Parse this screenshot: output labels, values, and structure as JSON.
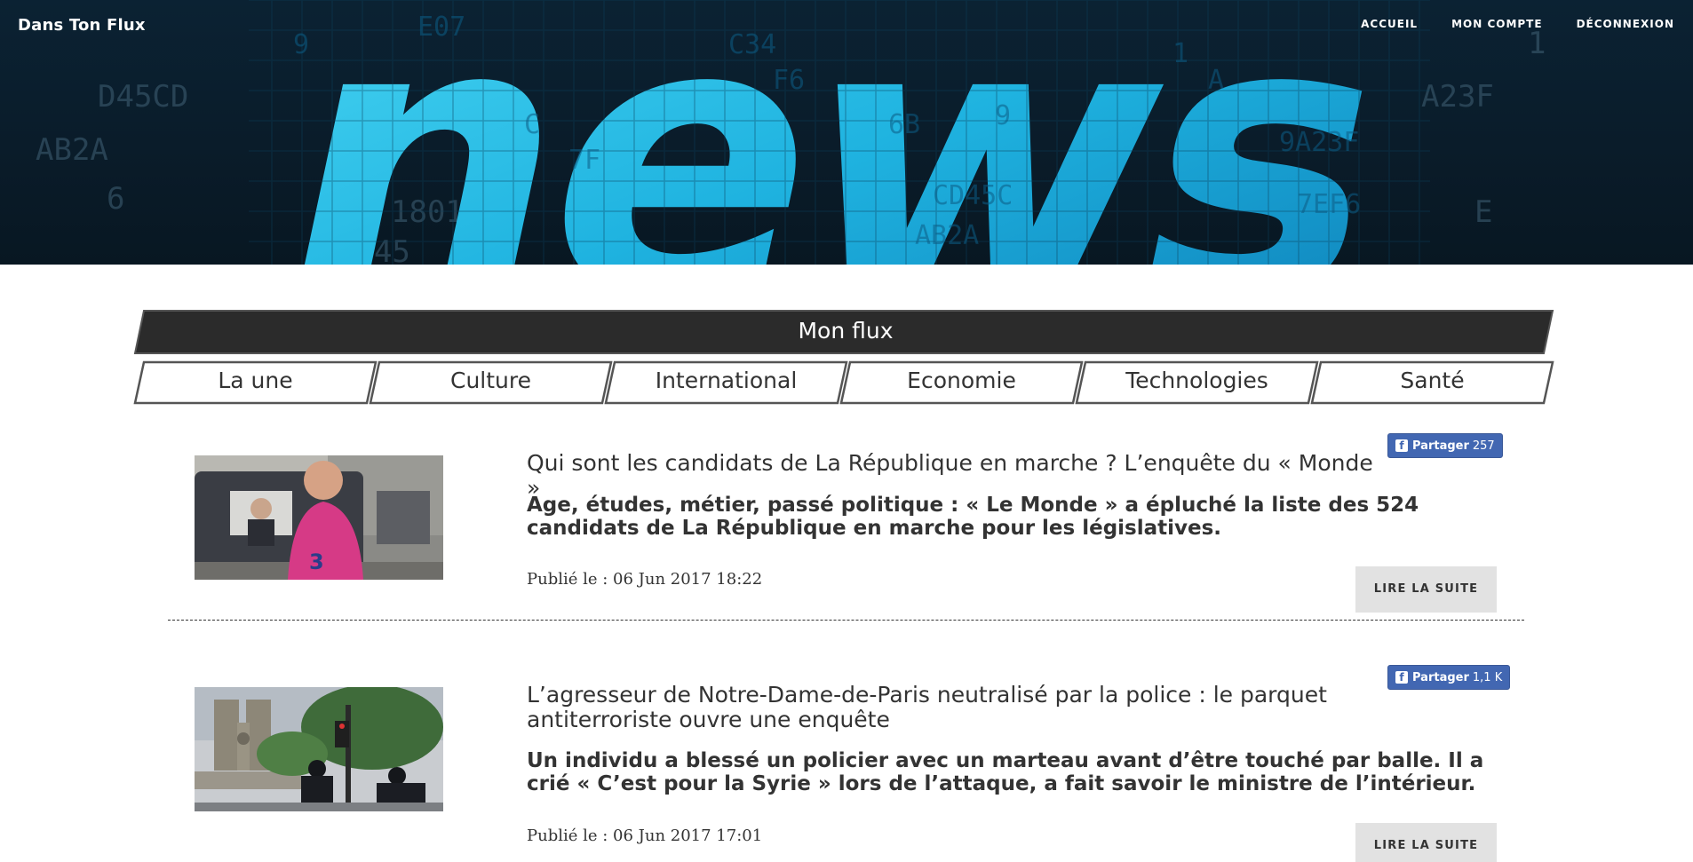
{
  "header": {
    "brand": "Dans Ton Flux",
    "nav": [
      {
        "label": "ACCUEIL"
      },
      {
        "label": "MON COMPTE"
      },
      {
        "label": "DÉCONNEXION"
      }
    ],
    "hero_word": "news"
  },
  "categories": {
    "main_label": "Mon flux",
    "tabs": [
      {
        "label": "La une"
      },
      {
        "label": "Culture"
      },
      {
        "label": "International"
      },
      {
        "label": "Economie"
      },
      {
        "label": "Technologies"
      },
      {
        "label": "Santé"
      }
    ]
  },
  "articles": [
    {
      "title": "Qui sont les candidats de La République en marche ? L’enquête du « Monde »",
      "subtitle": "Age, études, métier, passé politique : « Le Monde » a épluché la liste des 524 candidats de La République en marche pour les législatives.",
      "date": "Publié le : 06 Jun 2017 18:22",
      "share_label": "Partager",
      "share_count": "257",
      "read_more": "LIRE LA SUITE",
      "thumbnail": "campaign-van-photo"
    },
    {
      "title": "L’agresseur de Notre-Dame-de-Paris neutralisé par la police : le parquet antiterroriste ouvre une enquête",
      "subtitle": "Un individu a blessé un policier avec un marteau avant d’être touché par balle. Il a crié « C’est pour la Syrie » lors de l’attaque, a fait savoir le ministre de l’intérieur.",
      "date": "Publié le : 06 Jun 2017 17:01",
      "share_label": "Partager",
      "share_count": "1,1 K",
      "read_more": "LIRE LA SUITE",
      "thumbnail": "notre-dame-police-photo"
    }
  ],
  "colors": {
    "banner_dark": "#2b2b2b",
    "tab_border": "#555555",
    "facebook_blue": "#4267b2",
    "read_more_bg": "#e2e2e2",
    "hero_cyan": "#2fc7ea"
  }
}
